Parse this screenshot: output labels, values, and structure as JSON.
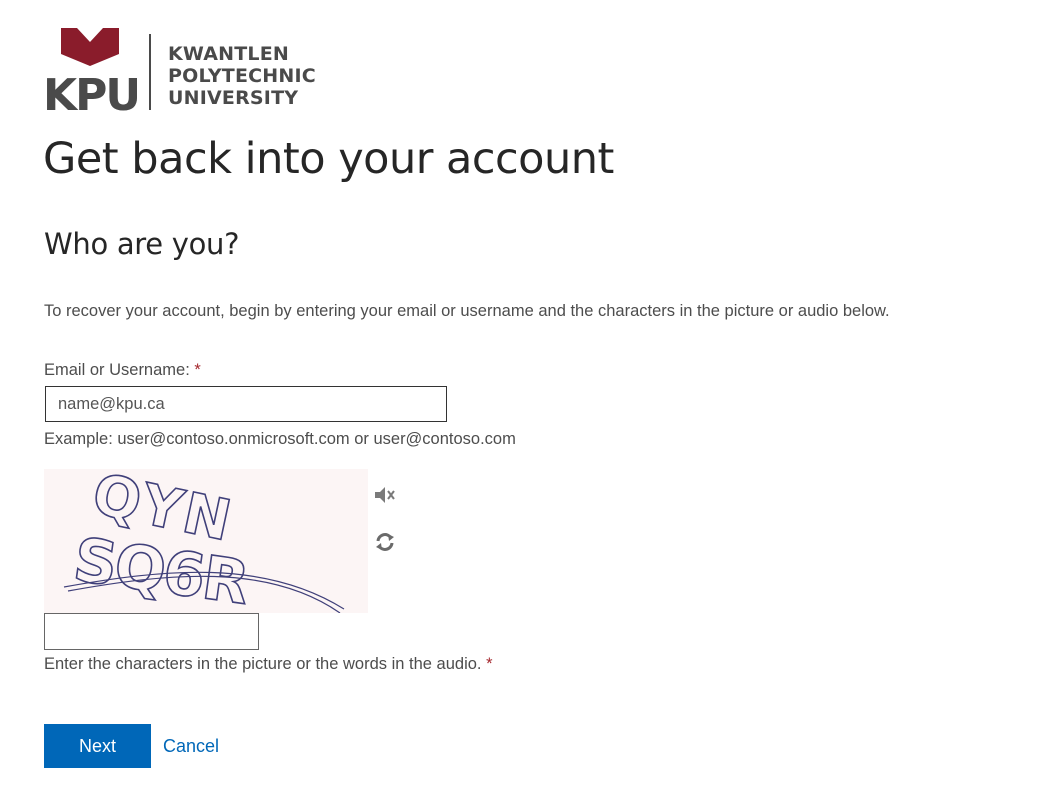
{
  "logo": {
    "abbr": "KPU",
    "line1": "KWANTLEN",
    "line2": "POLYTECHNIC",
    "line3": "UNIVERSITY",
    "brand_color": "#8a1c2b",
    "text_color": "#4a4a4a"
  },
  "title": "Get back into your account",
  "subtitle": "Who are you?",
  "intro": "To recover your account, begin by entering your email or username and the characters in the picture or audio below.",
  "email": {
    "label": "Email or Username:",
    "required_mark": "*",
    "placeholder": "name@kpu.ca",
    "value": "",
    "example": "Example: user@contoso.onmicrosoft.com or user@contoso.com"
  },
  "captcha": {
    "image_text": "QYN SQ6R",
    "audio_icon": "speaker-icon",
    "refresh_icon": "refresh-icon",
    "input_value": "",
    "help": "Enter the characters in the picture or the words in the audio.",
    "required_mark": "*"
  },
  "actions": {
    "next_label": "Next",
    "cancel_label": "Cancel",
    "accent_color": "#0067b8"
  }
}
